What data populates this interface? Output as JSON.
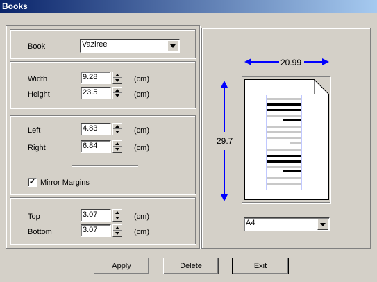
{
  "window": {
    "title": "Books"
  },
  "book": {
    "label": "Book",
    "value": "Vaziree"
  },
  "size": {
    "width_label": "Width",
    "width_value": "9.28",
    "width_unit": "(cm)",
    "height_label": "Height",
    "height_value": "23.5",
    "height_unit": "(cm)"
  },
  "margins": {
    "left_label": "Left",
    "left_value": "4.83",
    "left_unit": "(cm)",
    "right_label": "Right",
    "right_value": "6.84",
    "right_unit": "(cm)",
    "mirror_label": "Mirror Margins",
    "mirror_checked": true,
    "top_label": "Top",
    "top_value": "3.07",
    "top_unit": "(cm)",
    "bottom_label": "Bottom",
    "bottom_value": "3.07",
    "bottom_unit": "(cm)"
  },
  "preview": {
    "paper_width": "20.99",
    "paper_height": "29.7",
    "paper_size": "A4",
    "arrow_color": "#0000ff"
  },
  "buttons": {
    "apply": "Apply",
    "delete": "Delete",
    "exit": "Exit"
  }
}
